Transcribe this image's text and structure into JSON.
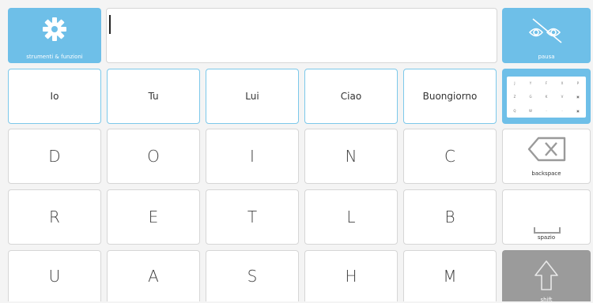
{
  "toolbar": {
    "settings_label": "strumenti & funzioni",
    "pause_label": "pausa"
  },
  "text_input": {
    "value": ""
  },
  "words": [
    "Io",
    "Tu",
    "Lui",
    "Ciao",
    "Buongiorno"
  ],
  "letters": {
    "row1": [
      "D",
      "O",
      "I",
      "N",
      "C"
    ],
    "row2": [
      "R",
      "E",
      "T",
      "L",
      "B"
    ],
    "row3": [
      "U",
      "A",
      "S",
      "H",
      "M"
    ]
  },
  "keyboard_preview": [
    "J",
    "Y",
    "F",
    "X",
    "P",
    "Z",
    "G",
    "K",
    "V",
    "",
    "Q",
    "W",
    "",
    "",
    ""
  ],
  "side": {
    "backspace_label": "backspace",
    "space_label": "spazio",
    "shift_label": "shift"
  },
  "colors": {
    "accent": "#6ebfe8",
    "shift_bg": "#9b9b9b",
    "word_border": "#7cc8ea"
  }
}
